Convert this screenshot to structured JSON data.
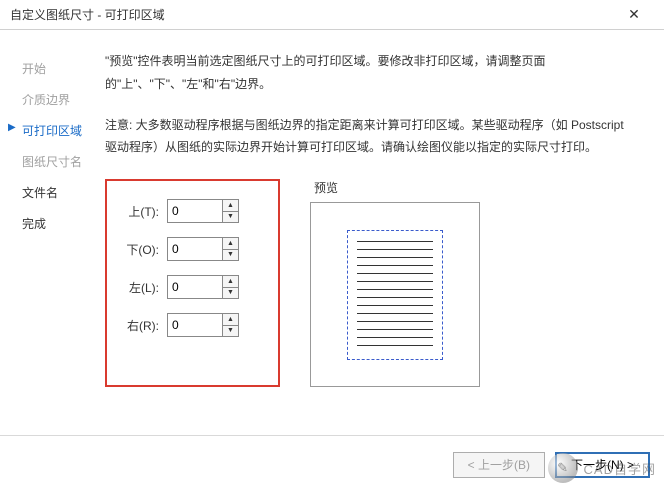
{
  "window": {
    "title": "自定义图纸尺寸 - 可打印区域"
  },
  "sidebar": {
    "items": [
      {
        "label": "开始",
        "state": "gray"
      },
      {
        "label": "介质边界",
        "state": "gray"
      },
      {
        "label": "可打印区域",
        "state": "active"
      },
      {
        "label": "图纸尺寸名",
        "state": "gray"
      },
      {
        "label": "文件名",
        "state": "dark"
      },
      {
        "label": "完成",
        "state": "dark"
      }
    ]
  },
  "main": {
    "desc": "\"预览\"控件表明当前选定图纸尺寸上的可打印区域。要修改非打印区域，请调整页面的\"上\"、\"下\"、\"左\"和\"右\"边界。",
    "note": "注意: 大多数驱动程序根据与图纸边界的指定距离来计算可打印区域。某些驱动程序（如 Postscript 驱动程序）从图纸的实际边界开始计算可打印区域。请确认绘图仪能以指定的实际尺寸打印。",
    "margins": {
      "top": {
        "label": "上(T):",
        "value": "0"
      },
      "bottom": {
        "label": "下(O):",
        "value": "0"
      },
      "left": {
        "label": "左(L):",
        "value": "0"
      },
      "right": {
        "label": "右(R):",
        "value": "0"
      }
    },
    "preview_label": "预览"
  },
  "footer": {
    "back": "< 上一步(B)",
    "next": "下一步(N) >"
  },
  "watermark": {
    "text": "CAD自学网"
  }
}
